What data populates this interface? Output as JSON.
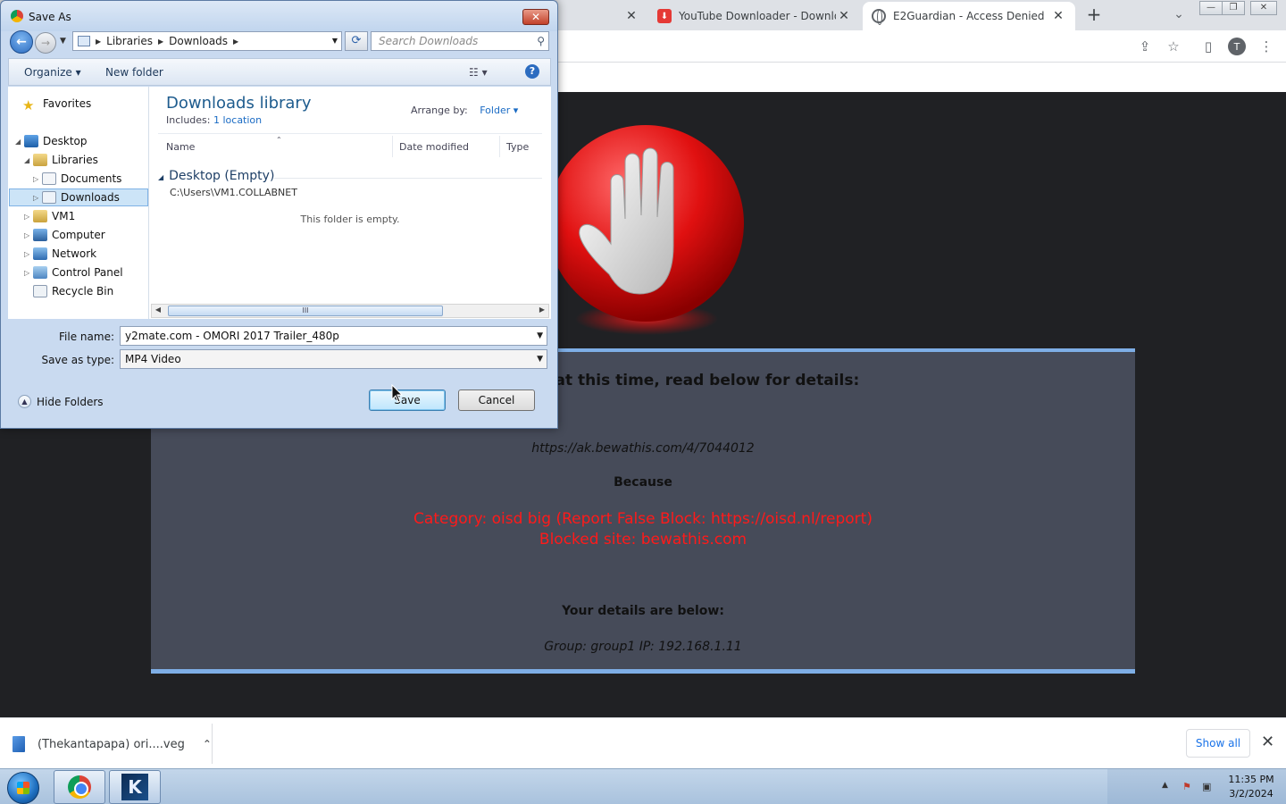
{
  "browser": {
    "tabs": [
      {
        "title": "",
        "close": "✕"
      },
      {
        "title": "YouTube Downloader - Download",
        "close": "✕"
      },
      {
        "title": "E2Guardian - Access Denied",
        "close": "✕"
      }
    ],
    "new_tab": "+",
    "tab_search": "⌄",
    "window_controls": {
      "minimize": "—",
      "maximize": "❐",
      "close": "✕"
    },
    "avatar_letter": "T",
    "toolbar_icons": [
      "share-icon",
      "star-icon",
      "sidebar-icon",
      "menu-icon"
    ]
  },
  "blocked_page": {
    "headline": "viewed at this time, read below for details:",
    "url": "https://ak.bewathis.com/4/7044012",
    "because": "Because",
    "reason_line1": "Category: oisd big (Report False Block: https://oisd.nl/report)",
    "reason_line2": "Blocked site: bewathis.com",
    "details_heading": "Your details are below:",
    "details": "Group: group1   IP: 192.168.1.11",
    "colors": {
      "panel": "#464b59",
      "border": "#7eaee6",
      "reason": "#ff1a1a"
    }
  },
  "download_bar": {
    "item_name": "(Thekantapapa) ori....veg",
    "item_chevron": "⌃",
    "show_all": "Show all",
    "close": "✕"
  },
  "taskbar": {
    "clock_time": "11:35 PM",
    "clock_date": "3/2/2024",
    "tray_arrow": "▲"
  },
  "dialog": {
    "title": "Save As",
    "close": "✕",
    "back_arrow": "←",
    "fwd_arrow": "→",
    "breadcrumbs": [
      "Libraries",
      "Downloads"
    ],
    "search_placeholder": "Search Downloads",
    "organize": "Organize ▾",
    "new_folder": "New folder",
    "view_icon": "☷ ▾",
    "help": "?",
    "nav_tree": [
      {
        "label": "Favorites"
      },
      {
        "label": "Desktop"
      },
      {
        "label": "Libraries"
      },
      {
        "label": "Documents"
      },
      {
        "label": "Downloads"
      },
      {
        "label": "VM1"
      },
      {
        "label": "Computer"
      },
      {
        "label": "Network"
      },
      {
        "label": "Control Panel"
      },
      {
        "label": "Recycle Bin"
      }
    ],
    "library_title": "Downloads library",
    "includes_label": "Includes:",
    "includes_link": "1 location",
    "arrange_label": "Arrange by:",
    "arrange_value": "Folder ▾",
    "columns": [
      "Name",
      "Date modified",
      "Type"
    ],
    "group_head": "Desktop (Empty)",
    "group_path": "C:\\Users\\VM1.COLLABNET",
    "empty_message": "This folder is empty.",
    "scroll_grip": "III",
    "file_name_label": "File name:",
    "file_name_value": "y2mate.com - OMORI 2017 Trailer_480p",
    "save_type_label": "Save as type:",
    "save_type_value": "MP4 Video",
    "hide_folders": "Hide Folders",
    "save_button": "Save",
    "cancel_button": "Cancel"
  }
}
